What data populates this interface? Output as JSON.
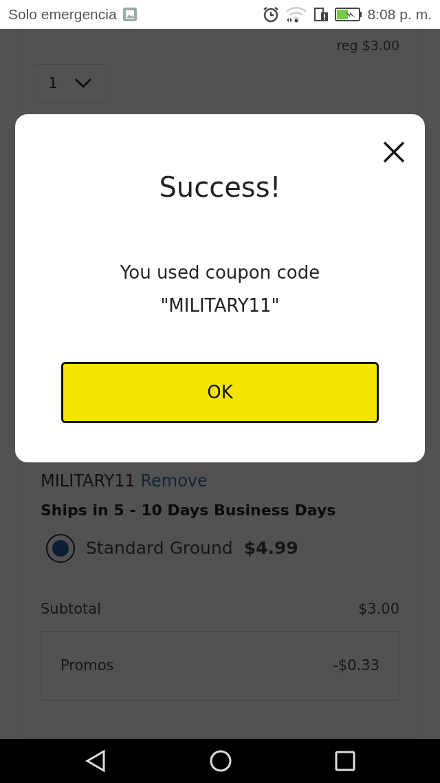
{
  "status_bar": {
    "carrier": "Solo emergencia",
    "time": "8:08 p. m."
  },
  "product": {
    "regular_price": "reg $3.00",
    "quantity": "1"
  },
  "coupon": {
    "code": "MILITARY11",
    "remove_link": "Remove"
  },
  "shipping": {
    "heading": "Ships in 5 - 10 Days Business Days",
    "options": [
      {
        "label": "Standard Ground",
        "price": "$4.99",
        "selected": true
      }
    ]
  },
  "summary": {
    "rows": [
      {
        "kind": "plain",
        "label": "Subtotal",
        "value": "$3.00"
      },
      {
        "kind": "boxed",
        "label": "Promos",
        "value": "-$0.33"
      }
    ]
  },
  "dialog": {
    "title": "Success!",
    "message": "You used coupon code \"MILITARY11\"",
    "button": "OK"
  }
}
